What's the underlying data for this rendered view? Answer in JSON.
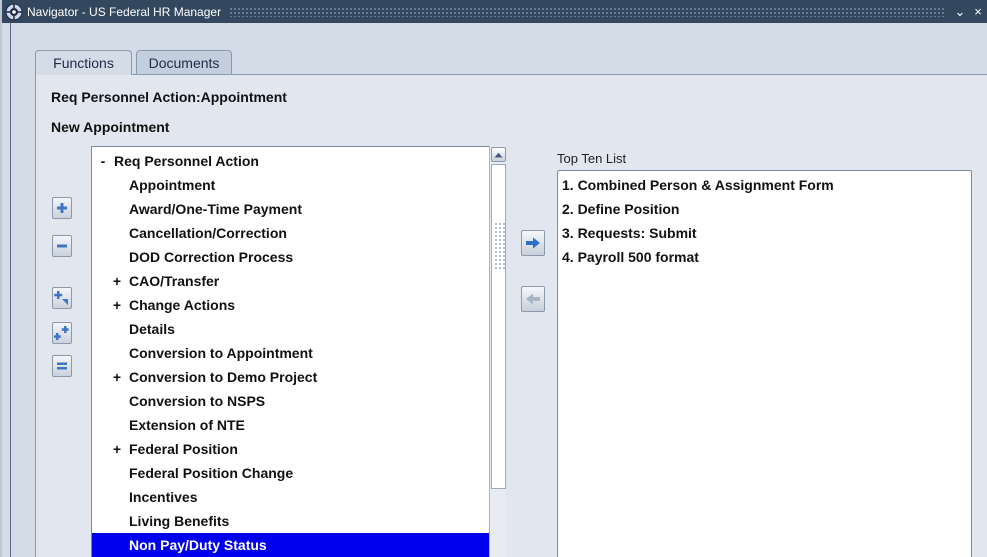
{
  "window": {
    "title": "Navigator - US Federal HR Manager",
    "minimize_glyph": "⌄",
    "close_glyph": "×"
  },
  "tabs": [
    {
      "label": "Functions",
      "active": true
    },
    {
      "label": "Documents",
      "active": false
    }
  ],
  "header": {
    "breadcrumb": "Req Personnel Action:Appointment",
    "subtitle": "New Appointment"
  },
  "side_buttons": [
    {
      "name": "expand-icon"
    },
    {
      "name": "collapse-icon"
    },
    {
      "name": "expand-branch-icon"
    },
    {
      "name": "expand-all-icon"
    },
    {
      "name": "collapse-all-icon"
    }
  ],
  "tree": {
    "items": [
      {
        "label": "Req Personnel Action",
        "expander": "-",
        "level": 0
      },
      {
        "label": "Appointment",
        "expander": "",
        "level": 1
      },
      {
        "label": "Award/One-Time Payment",
        "expander": "",
        "level": 1
      },
      {
        "label": "Cancellation/Correction",
        "expander": "",
        "level": 1
      },
      {
        "label": "DOD Correction Process",
        "expander": "",
        "level": 1
      },
      {
        "label": "CAO/Transfer",
        "expander": "+",
        "level": 1
      },
      {
        "label": "Change Actions",
        "expander": "+",
        "level": 1
      },
      {
        "label": "Details",
        "expander": "",
        "level": 1
      },
      {
        "label": "Conversion to Appointment",
        "expander": "",
        "level": 1
      },
      {
        "label": "Conversion to Demo Project",
        "expander": "+",
        "level": 1
      },
      {
        "label": "Conversion to NSPS",
        "expander": "",
        "level": 1
      },
      {
        "label": "Extension of NTE",
        "expander": "",
        "level": 1
      },
      {
        "label": "Federal Position",
        "expander": "+",
        "level": 1
      },
      {
        "label": "Federal Position Change",
        "expander": "",
        "level": 1
      },
      {
        "label": "Incentives",
        "expander": "",
        "level": 1
      },
      {
        "label": "Living Benefits",
        "expander": "",
        "level": 1
      },
      {
        "label": "Non Pay/Duty Status",
        "expander": "",
        "level": 1,
        "selected": true
      }
    ]
  },
  "top_ten": {
    "label": "Top Ten List",
    "items": [
      "1. Combined Person & Assignment Form",
      "2. Define Position",
      "3. Requests: Submit",
      "4. Payroll 500 format"
    ]
  },
  "colors": {
    "titlebar": "#33475f",
    "selection": "#0000ee",
    "panel": "#e2e7ef",
    "arrow_active": "#2f6fc8",
    "arrow_disabled": "#a9b4c4"
  }
}
